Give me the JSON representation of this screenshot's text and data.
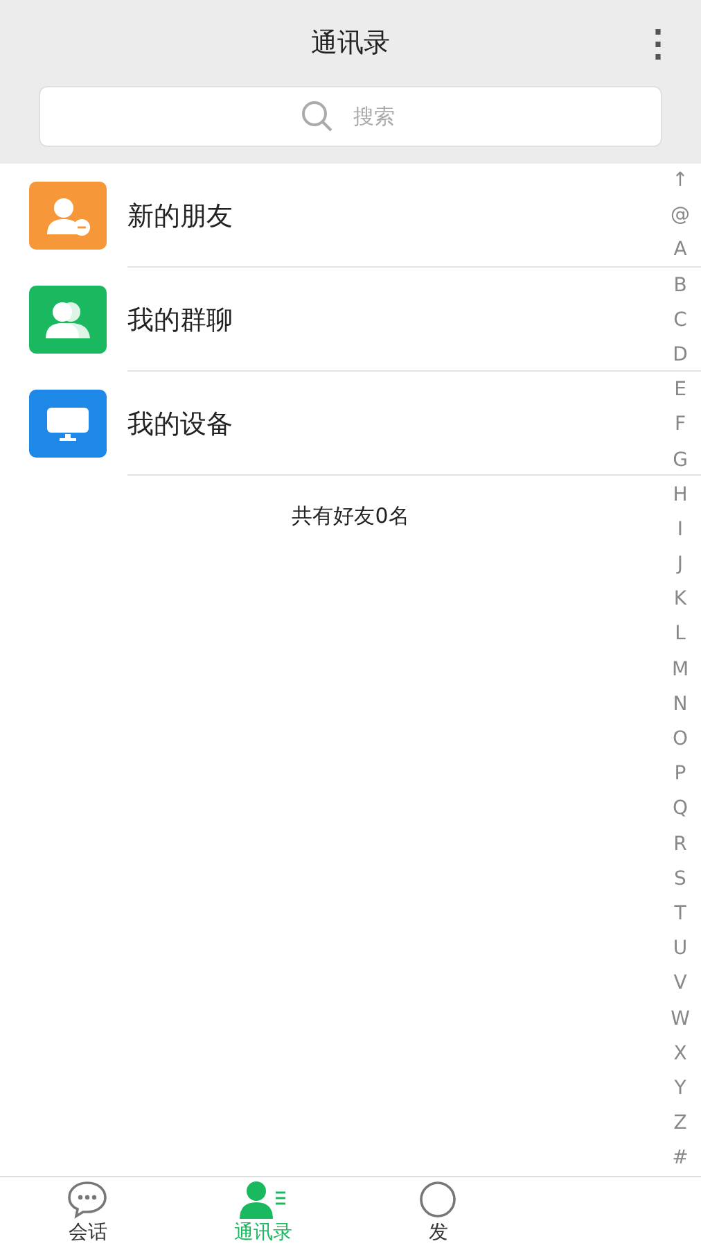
{
  "header": {
    "title": "通讯录",
    "menu_icon": "⋮"
  },
  "search": {
    "placeholder": "搜索"
  },
  "entries": [
    {
      "label": "新的朋友",
      "kind": "new-friend",
      "color": "#f6973a"
    },
    {
      "label": "我的群聊",
      "kind": "group",
      "color": "#1bb95f"
    },
    {
      "label": "我的设备",
      "kind": "device",
      "color": "#1e88e8"
    }
  ],
  "friend_count": "共有好友0名",
  "index": [
    "↑",
    "@",
    "A",
    "B",
    "C",
    "D",
    "E",
    "F",
    "G",
    "H",
    "I",
    "J",
    "K",
    "L",
    "M",
    "N",
    "O",
    "P",
    "Q",
    "R",
    "S",
    "T",
    "U",
    "V",
    "W",
    "X",
    "Y",
    "Z",
    "#"
  ],
  "tabs": [
    {
      "label": "会话",
      "kind": "chat",
      "selected": false
    },
    {
      "label": "通讯录",
      "kind": "contacts",
      "selected": true
    },
    {
      "label": "发",
      "kind": "discover",
      "selected": false
    }
  ]
}
